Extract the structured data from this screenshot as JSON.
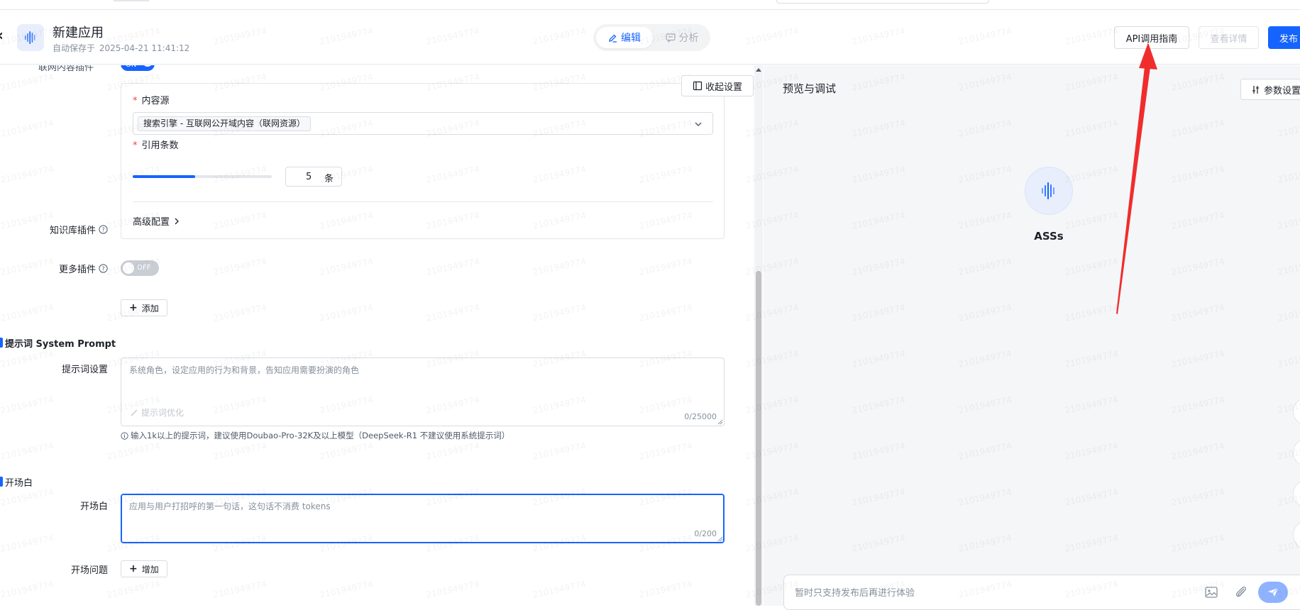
{
  "header": {
    "back_glyph": "‹",
    "app_title": "新建应用",
    "autosave_prefix": "自动保存于",
    "autosave_time": "2025-04-21 11:41:12",
    "mode_edit": "编辑",
    "mode_analysis": "分析",
    "api_guide": "API调用指南",
    "view_detail": "查看详情",
    "publish": "发布"
  },
  "config": {
    "collapse_settings": "收起设置",
    "toggle_on": "ON",
    "partial_label": "联网内容插件",
    "content_source_label": "内容源",
    "content_source_value": "搜索引擎 - 互联网公开域内容（联网资源）",
    "citation_count_label": "引用条数",
    "citation_count_value": "5",
    "citation_count_unit": "条",
    "citation_slider_fraction": 0.45,
    "advanced_config": "高级配置",
    "knowledge_plugin_label": "知识库插件",
    "knowledge_toggle": "OFF",
    "more_plugins_label": "更多插件",
    "add_button": "添加",
    "prompt_section_title": "提示词 System Prompt",
    "prompt_setting_label": "提示词设置",
    "prompt_placeholder": "系统角色，设定应用的行为和背景，告知应用需要扮演的角色",
    "prompt_optimize": "提示词优化",
    "prompt_count": "0/25000",
    "prompt_hint": "输入1k以上的提示词，建议使用Doubao-Pro-32K及以上模型（DeepSeek-R1 不建议使用系统提示词）",
    "opening_section_title": "开场白",
    "opening_label": "开场白",
    "opening_placeholder": "应用与用户打招呼的第一句话，这句话不消费 tokens",
    "opening_count": "0/200",
    "opening_questions_label": "开场问题",
    "increase_button": "增加"
  },
  "preview": {
    "title": "预览与调试",
    "param_settings": "参数设置",
    "bot_name": "ASSs",
    "chat_placeholder": "暂时只支持发布后再进行体验"
  },
  "watermark_text": "2101949774",
  "colors": {
    "accent": "#1664ff",
    "annotation_arrow": "#f02d2d"
  }
}
